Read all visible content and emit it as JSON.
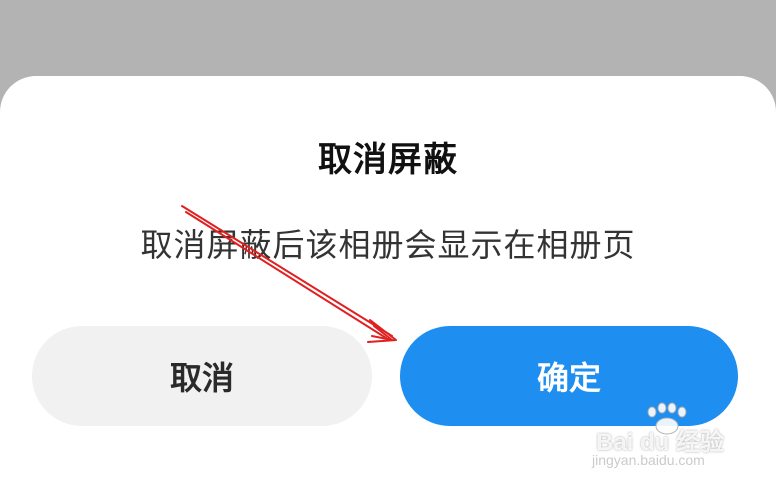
{
  "dialog": {
    "title": "取消屏蔽",
    "message": "取消屏蔽后该相册会显示在相册页",
    "cancel_label": "取消",
    "confirm_label": "确定"
  },
  "colors": {
    "backdrop": "#b3b3b3",
    "dialog_background": "#ffffff",
    "confirm_button": "#1f8ef1",
    "cancel_button": "#f1f1f1",
    "annotation_arrow": "#e02020"
  },
  "annotation": {
    "icon": "red-arrow-icon"
  },
  "watermark": {
    "brand": "Bai du 经验",
    "url": "jingyan.baidu.com"
  }
}
